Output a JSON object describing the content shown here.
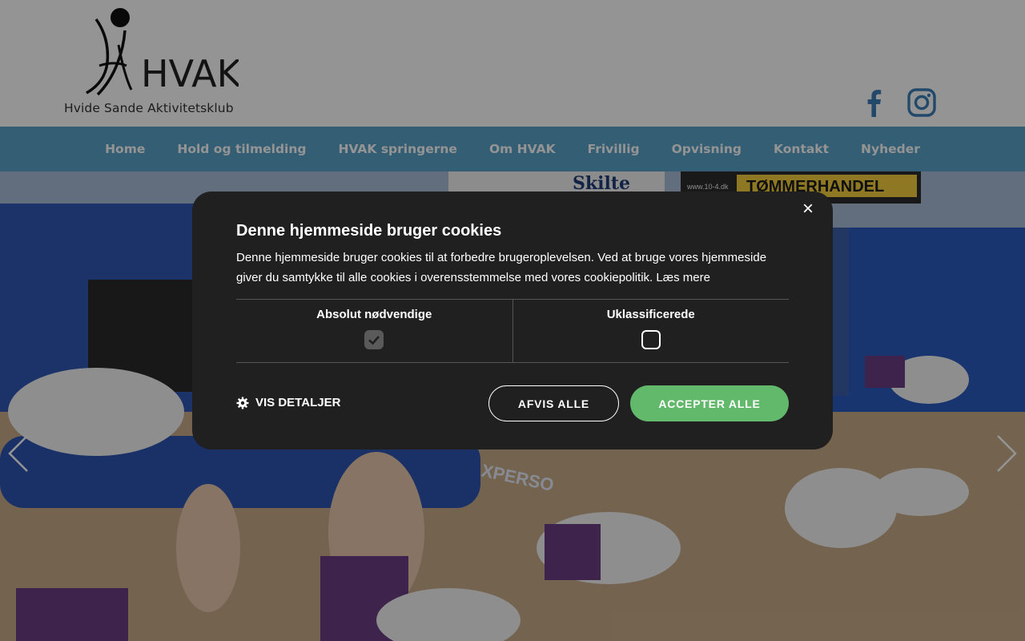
{
  "header": {
    "logo_text": "HVAK",
    "logo_subtitle": "Hvide Sande Aktivitetsklub",
    "social": [
      {
        "icon": "facebook-icon",
        "color": "#3b7fb5"
      },
      {
        "icon": "instagram-icon",
        "color": "#3b7fb5"
      }
    ]
  },
  "nav": {
    "items": [
      {
        "label": "Home"
      },
      {
        "label": "Hold og tilmelding"
      },
      {
        "label": "HVAK springerne"
      },
      {
        "label": "Om HVAK"
      },
      {
        "label": "Frivillig"
      },
      {
        "label": "Opvisning"
      },
      {
        "label": "Kontakt"
      },
      {
        "label": "Nyheder"
      }
    ],
    "background": "#5aa3c9"
  },
  "hero": {
    "banner_1": "Skilte",
    "banner_2": "TØMMERHANDEL",
    "banner_url": "www.10-4.dk",
    "mat_text": "XPERSO",
    "prev_icon": "chevron-left-icon",
    "next_icon": "chevron-right-icon"
  },
  "cookie": {
    "title": "Denne hjemmeside bruger cookies",
    "text": "Denne hjemmeside bruger cookies til at forbedre brugeroplevelsen. Ved at bruge vores hjemmeside giver du samtykke til alle cookies i overensstemmelse med vores cookiepolitik.",
    "read_more": "Læs mere",
    "close": "×",
    "categories": [
      {
        "label": "Absolut nødvendige",
        "checked": true
      },
      {
        "label": "Uklassificerede",
        "checked": false
      }
    ],
    "details_label": "VIS DETALJER",
    "reject_label": "AFVIS ALLE",
    "accept_label": "ACCEPTER ALLE",
    "accept_color": "#63b96b"
  }
}
